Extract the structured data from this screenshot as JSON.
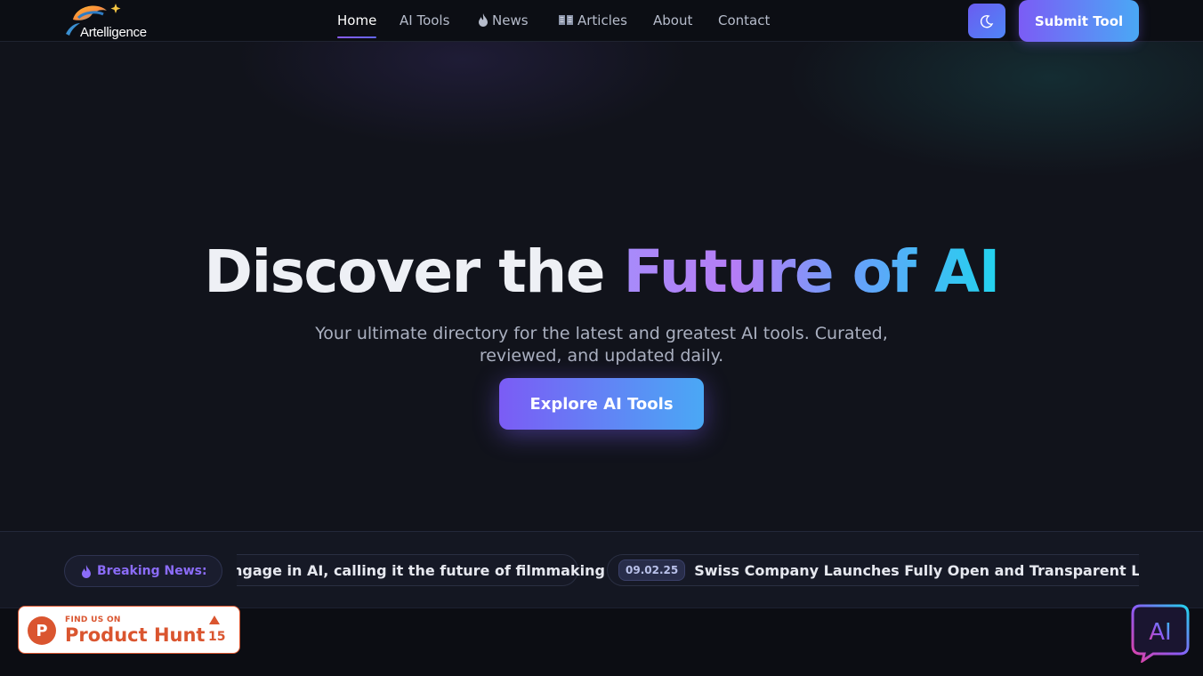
{
  "brand": {
    "name": "Artelligence"
  },
  "nav": {
    "items": [
      {
        "label": "Home",
        "icon": ""
      },
      {
        "label": "AI Tools",
        "icon": ""
      },
      {
        "label": "News",
        "icon": "flame-icon"
      },
      {
        "label": "Articles",
        "icon": "book-icon"
      },
      {
        "label": "About",
        "icon": ""
      },
      {
        "label": "Contact",
        "icon": ""
      }
    ],
    "active": "Home"
  },
  "header": {
    "theme_toggle_icon": "moon-icon",
    "submit_label": "Submit Tool"
  },
  "hero": {
    "title_plain": "Discover the",
    "title_gradient": "Future of AI",
    "subtitle": "Your ultimate directory for the latest and greatest AI tools. Curated, reviewed, and updated daily.",
    "cta_label": "Explore AI Tools"
  },
  "ticker": {
    "label": "Breaking News:",
    "items": [
      {
        "date": "",
        "text": "ngage in AI, calling it the future of filmmaking"
      },
      {
        "date": "09.02.25",
        "text": "Swiss Company Launches Fully Open and Transparent Large La"
      }
    ]
  },
  "product_hunt": {
    "eyebrow": "FIND US ON",
    "name": "Product Hunt",
    "logo_letter": "P",
    "upvotes": "15"
  },
  "chat_widget": {
    "label": "AI"
  },
  "colors": {
    "accent_purple": "#7b5cf5",
    "accent_blue": "#4aa8f5",
    "product_hunt": "#da552f",
    "background": "#11131b"
  }
}
